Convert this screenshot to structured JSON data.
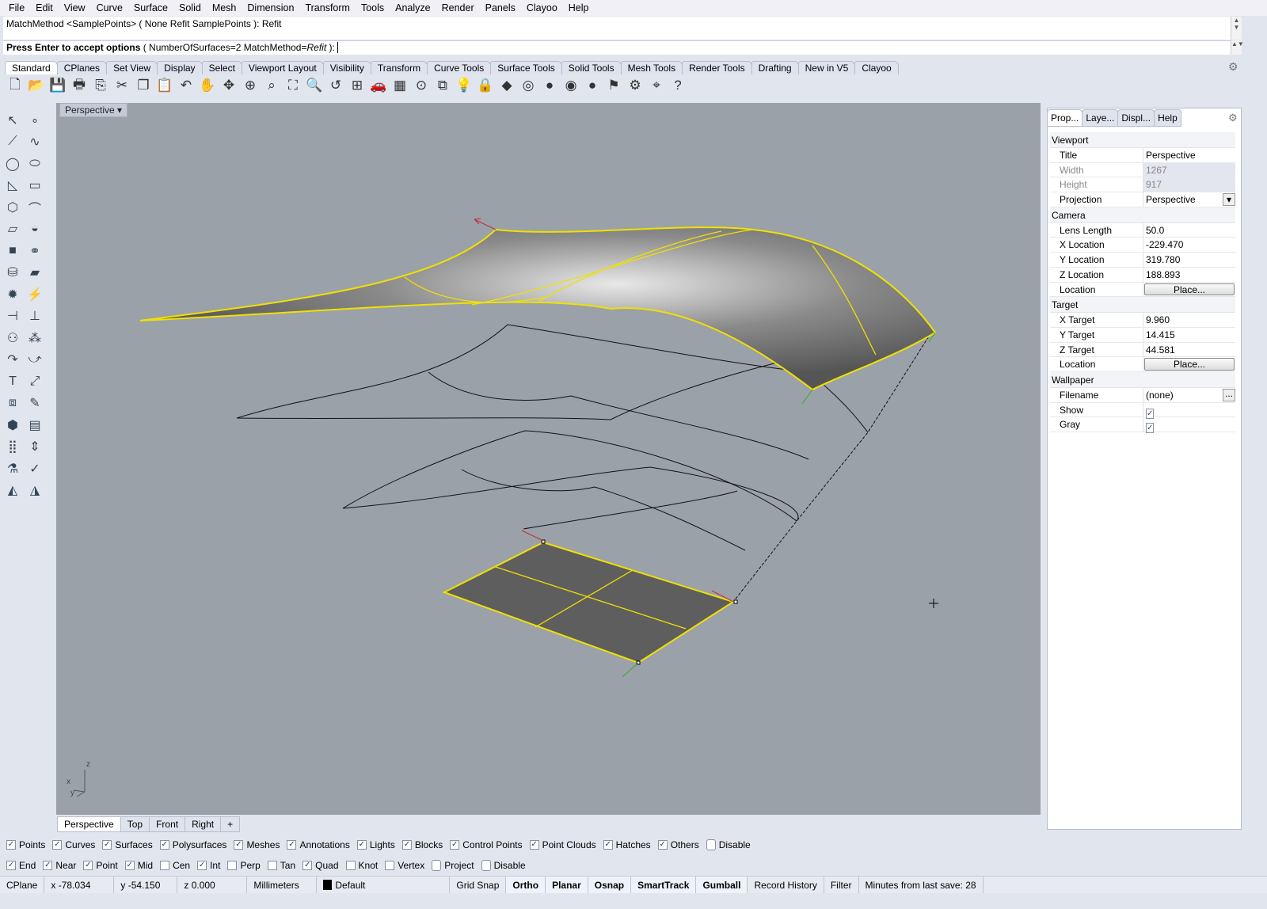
{
  "menu": [
    "File",
    "Edit",
    "View",
    "Curve",
    "Surface",
    "Solid",
    "Mesh",
    "Dimension",
    "Transform",
    "Tools",
    "Analyze",
    "Render",
    "Panels",
    "Clayoo",
    "Help"
  ],
  "command": {
    "history": "MatchMethod <SamplePoints> ( None  Refit  SamplePoints ): Refit",
    "prompt_bold": "Press Enter to accept options",
    "prompt_rest": " ( NumberOfSurfaces=2  MatchMethod=",
    "prompt_italic": "Refit",
    "prompt_end": " ):"
  },
  "toolbar_tabs": [
    "Standard",
    "CPlanes",
    "Set View",
    "Display",
    "Select",
    "Viewport Layout",
    "Visibility",
    "Transform",
    "Curve Tools",
    "Surface Tools",
    "Solid Tools",
    "Mesh Tools",
    "Render Tools",
    "Drafting",
    "New in V5",
    "Clayoo"
  ],
  "toolbar_icons": [
    [
      "new-icon",
      "🗋"
    ],
    [
      "open-icon",
      "📂"
    ],
    [
      "save-icon",
      "💾"
    ],
    [
      "print-icon",
      "🖶"
    ],
    [
      "export-icon",
      "⎘"
    ],
    [
      "cut-icon",
      "✂"
    ],
    [
      "copy-icon",
      "❐"
    ],
    [
      "paste-icon",
      "📋"
    ],
    [
      "undo-icon",
      "↶"
    ],
    [
      "pan-icon",
      "✋"
    ],
    [
      "rotate-view-icon",
      "✥"
    ],
    [
      "zoom-icon",
      "⊕"
    ],
    [
      "zoom-window-icon",
      "⌕"
    ],
    [
      "zoom-extents-icon",
      "⛶"
    ],
    [
      "zoom-selected-icon",
      "🔍"
    ],
    [
      "undo-view-icon",
      "↺"
    ],
    [
      "four-views-icon",
      "⊞"
    ],
    [
      "car-icon",
      "🚗"
    ],
    [
      "grid-icon",
      "▦"
    ],
    [
      "point-icon",
      "⊙"
    ],
    [
      "snap-icon",
      "⧉"
    ],
    [
      "light-icon",
      "💡"
    ],
    [
      "lock-icon",
      "🔒"
    ],
    [
      "layer-icon",
      "◆"
    ],
    [
      "color-wheel-icon",
      "◎"
    ],
    [
      "shade-icon",
      "●"
    ],
    [
      "rendered-icon",
      "◉"
    ],
    [
      "render-sphere-icon",
      "●"
    ],
    [
      "select-filter-icon",
      "⚑"
    ],
    [
      "settings-icon",
      "⚙"
    ],
    [
      "dimension-icon",
      "⌖"
    ],
    [
      "help-icon",
      "?"
    ]
  ],
  "left_icons": [
    [
      "select-arrow-icon",
      "↖"
    ],
    [
      "point-icon",
      "∘"
    ],
    [
      "polyline-icon",
      "⟋"
    ],
    [
      "curve-icon",
      "∿"
    ],
    [
      "circle-icon",
      "◯"
    ],
    [
      "ellipse-icon",
      "⬭"
    ],
    [
      "arc-icon",
      "◺"
    ],
    [
      "rectangle-icon",
      "▭"
    ],
    [
      "polygon-icon",
      "⬡"
    ],
    [
      "fillet-icon",
      "⌒"
    ],
    [
      "surface-icon",
      "▱"
    ],
    [
      "loft-icon",
      "◒"
    ],
    [
      "box-icon",
      "■"
    ],
    [
      "boolean-icon",
      "⚭"
    ],
    [
      "cylinder-icon",
      "⛁"
    ],
    [
      "plane-icon",
      "▰"
    ],
    [
      "explode-icon",
      "✹"
    ],
    [
      "split-icon",
      "⚡"
    ],
    [
      "trim-icon",
      "⊣"
    ],
    [
      "extend-icon",
      "⊥"
    ],
    [
      "boolean-union-icon",
      "⚇"
    ],
    [
      "group-icon",
      "⁂"
    ],
    [
      "offset-icon",
      "↷"
    ],
    [
      "blend-icon",
      "⤻"
    ],
    [
      "text-icon",
      "T"
    ],
    [
      "scale-icon",
      "⤢"
    ],
    [
      "block-icon",
      "⧈"
    ],
    [
      "edit-icon",
      "✎"
    ],
    [
      "mesh-icon",
      "⬢"
    ],
    [
      "hatch-icon",
      "▤"
    ],
    [
      "array-icon",
      "⣿"
    ],
    [
      "align-icon",
      "⇕"
    ],
    [
      "analyze-icon",
      "⚗"
    ],
    [
      "check-icon",
      "✓"
    ],
    [
      "render-icon",
      "◭"
    ],
    [
      "material-icon",
      "◮"
    ]
  ],
  "viewport": {
    "title": "Perspective",
    "background": "#9ba1a9",
    "highlight": "#f0e000",
    "axes": {
      "z": "z",
      "x": "x",
      "y": "y"
    }
  },
  "view_tabs": [
    "Perspective",
    "Top",
    "Front",
    "Right",
    "+"
  ],
  "panel_tabs": [
    "Prop...",
    "Laye...",
    "Displ...",
    "Help"
  ],
  "properties": {
    "viewport": {
      "label": "Viewport",
      "rows": [
        {
          "k": "Title",
          "v": "Perspective"
        },
        {
          "k": "Width",
          "v": "1267",
          "disabled": true
        },
        {
          "k": "Height",
          "v": "917",
          "disabled": true
        },
        {
          "k": "Projection",
          "v": "Perspective",
          "dropdown": true
        }
      ]
    },
    "camera": {
      "label": "Camera",
      "rows": [
        {
          "k": "Lens Length",
          "v": "50.0"
        },
        {
          "k": "X Location",
          "v": "-229.470"
        },
        {
          "k": "Y Location",
          "v": "319.780"
        },
        {
          "k": "Z Location",
          "v": "188.893"
        },
        {
          "k": "Location",
          "button": "Place..."
        }
      ]
    },
    "target": {
      "label": "Target",
      "rows": [
        {
          "k": "X Target",
          "v": "9.960"
        },
        {
          "k": "Y Target",
          "v": "14.415"
        },
        {
          "k": "Z Target",
          "v": "44.581"
        },
        {
          "k": "Location",
          "button": "Place..."
        }
      ]
    },
    "wallpaper": {
      "label": "Wallpaper",
      "rows": [
        {
          "k": "Filename",
          "v": "(none)",
          "browse": "..."
        },
        {
          "k": "Show",
          "check": true
        },
        {
          "k": "Gray",
          "check": true
        }
      ]
    }
  },
  "filters": [
    {
      "l": "Points",
      "c": true
    },
    {
      "l": "Curves",
      "c": true
    },
    {
      "l": "Surfaces",
      "c": true
    },
    {
      "l": "Polysurfaces",
      "c": true
    },
    {
      "l": "Meshes",
      "c": true
    },
    {
      "l": "Annotations",
      "c": true
    },
    {
      "l": "Lights",
      "c": true
    },
    {
      "l": "Blocks",
      "c": true
    },
    {
      "l": "Control Points",
      "c": true
    },
    {
      "l": "Point Clouds",
      "c": true
    },
    {
      "l": "Hatches",
      "c": true
    },
    {
      "l": "Others",
      "c": true
    },
    {
      "l": "Disable",
      "c": false,
      "r": true
    }
  ],
  "osnaps": [
    {
      "l": "End",
      "c": true
    },
    {
      "l": "Near",
      "c": true
    },
    {
      "l": "Point",
      "c": true
    },
    {
      "l": "Mid",
      "c": true
    },
    {
      "l": "Cen",
      "c": false
    },
    {
      "l": "Int",
      "c": true
    },
    {
      "l": "Perp",
      "c": false
    },
    {
      "l": "Tan",
      "c": false
    },
    {
      "l": "Quad",
      "c": true
    },
    {
      "l": "Knot",
      "c": false
    },
    {
      "l": "Vertex",
      "c": false
    },
    {
      "l": "Project",
      "c": false,
      "r": true
    },
    {
      "l": "Disable",
      "c": false,
      "r": true
    }
  ],
  "status": {
    "cplane": "CPlane",
    "x": "x -78.034",
    "y": "y -54.150",
    "z": "z 0.000",
    "units": "Millimeters",
    "layer": "Default",
    "layer_color": "#000000",
    "toggles": [
      {
        "l": "Grid Snap",
        "on": false
      },
      {
        "l": "Ortho",
        "on": true
      },
      {
        "l": "Planar",
        "on": true
      },
      {
        "l": "Osnap",
        "on": true
      },
      {
        "l": "SmartTrack",
        "on": true
      },
      {
        "l": "Gumball",
        "on": true
      },
      {
        "l": "Record History",
        "on": false
      },
      {
        "l": "Filter",
        "on": false
      }
    ],
    "save": "Minutes from last save: 28"
  }
}
